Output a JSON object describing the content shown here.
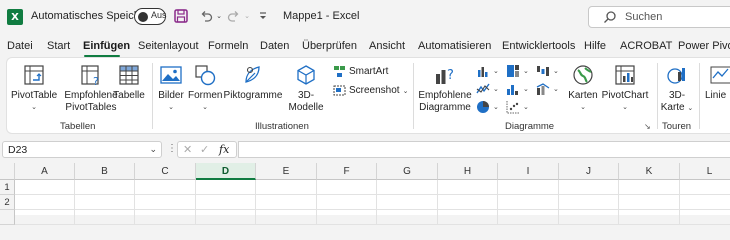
{
  "titlebar": {
    "app_icon": "excel-icon",
    "autosave_label": "Automatisches Speichern",
    "autosave_state": "Aus",
    "document_title": "Mappe1  -  Excel",
    "search_placeholder": "Suchen"
  },
  "menu": {
    "tabs": [
      {
        "label": "Datei"
      },
      {
        "label": "Start"
      },
      {
        "label": "Einfügen"
      },
      {
        "label": "Seitenlayout"
      },
      {
        "label": "Formeln"
      },
      {
        "label": "Daten"
      },
      {
        "label": "Überprüfen"
      },
      {
        "label": "Ansicht"
      },
      {
        "label": "Automatisieren"
      },
      {
        "label": "Entwicklertools"
      },
      {
        "label": "Hilfe"
      },
      {
        "label": "ACROBAT"
      },
      {
        "label": "Power Pivot"
      }
    ],
    "active_tab": "Einfügen"
  },
  "ribbon": {
    "groups": {
      "tables": "Tabellen",
      "illustrations": "Illustrationen",
      "charts": "Diagramme",
      "tours": "Touren"
    },
    "items": {
      "pivottable": "PivotTable",
      "recommended_pivottables_1": "Empfohlene",
      "recommended_pivottables_2": "PivotTables",
      "table": "Tabelle",
      "pictures": "Bilder",
      "shapes": "Formen",
      "icons": "Piktogramme",
      "models_1": "3D-",
      "models_2": "Modelle",
      "smartart": "SmartArt",
      "screenshot": "Screenshot",
      "recommended_charts_1": "Empfohlene",
      "recommended_charts_2": "Diagramme",
      "maps": "Karten",
      "pivotchart": "PivotChart",
      "map3d_1": "3D-",
      "map3d_2": "Karte",
      "line": "Linie"
    }
  },
  "formula": {
    "namebox_value": "D23",
    "fx_label": "fx",
    "content": ""
  },
  "grid": {
    "columns": [
      "A",
      "B",
      "C",
      "D",
      "E",
      "F",
      "G",
      "H",
      "I",
      "J",
      "K",
      "L"
    ],
    "selected_column": "D",
    "rows": [
      "1",
      "2"
    ]
  },
  "colors": {
    "accent": "#107c41",
    "ribbon_bg": "#ffffff",
    "chrome_bg": "#f3f3f3"
  }
}
